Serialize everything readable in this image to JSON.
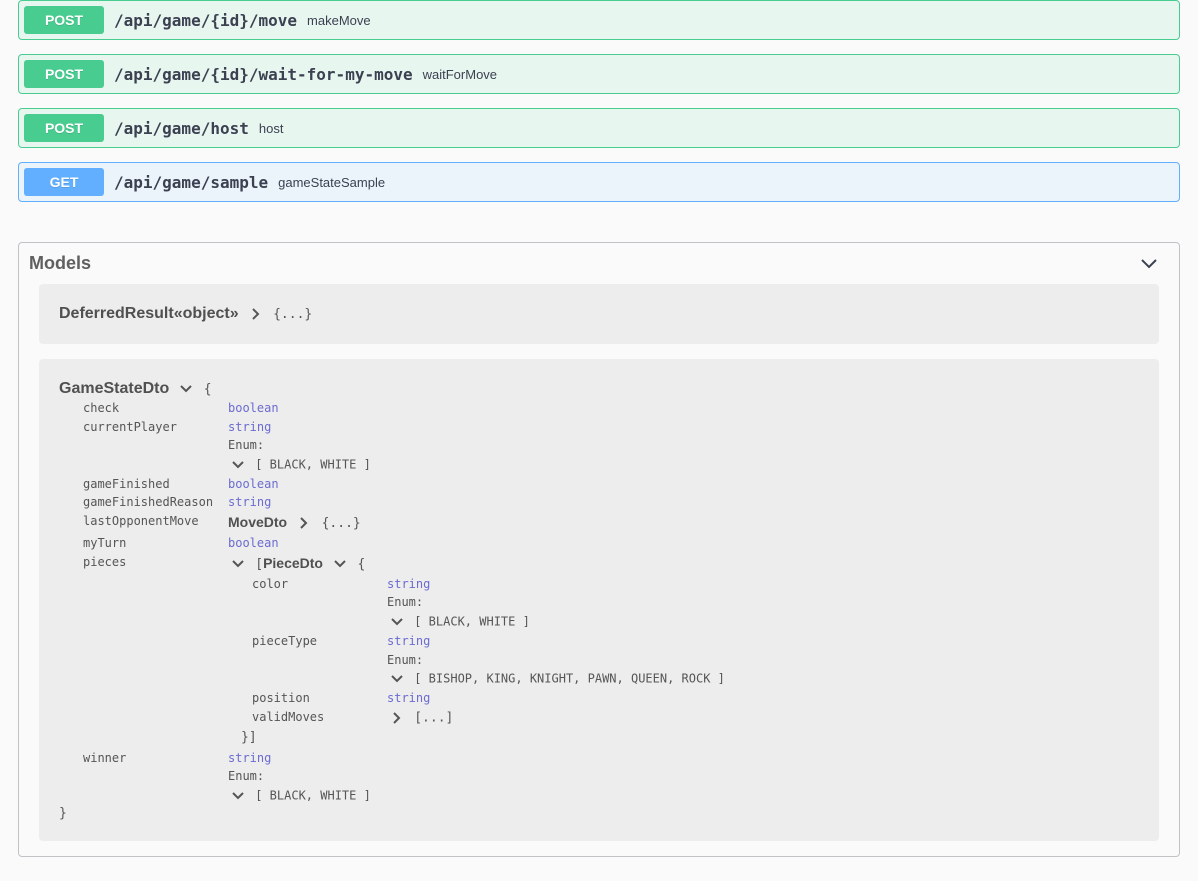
{
  "endpoints": [
    {
      "method": "POST",
      "path": "/api/game/{id}/move",
      "summary": "makeMove",
      "cls": "post"
    },
    {
      "method": "POST",
      "path": "/api/game/{id}/wait-for-my-move",
      "summary": "waitForMove",
      "cls": "post"
    },
    {
      "method": "POST",
      "path": "/api/game/host",
      "summary": "host",
      "cls": "post"
    },
    {
      "method": "GET",
      "path": "/api/game/sample",
      "summary": "gameStateSample",
      "cls": "get"
    }
  ],
  "models": {
    "section_title": "Models",
    "collapsed_preview": "{...}",
    "deferred": {
      "name": "DeferredResult«object»",
      "preview": "{...}"
    },
    "gamestate": {
      "name": "GameStateDto",
      "open": "{",
      "close": "}",
      "props": {
        "check": {
          "label": "check",
          "type": "boolean"
        },
        "currentPlayer": {
          "label": "currentPlayer",
          "type": "string",
          "enum_label": "Enum:",
          "enum": "[ BLACK, WHITE ]"
        },
        "gameFinished": {
          "label": "gameFinished",
          "type": "boolean"
        },
        "gameFinishedReason": {
          "label": "gameFinishedReason",
          "type": "string"
        },
        "lastOpponentMove": {
          "label": "lastOpponentMove",
          "ref": "MoveDto",
          "preview": "{...}"
        },
        "myTurn": {
          "label": "myTurn",
          "type": "boolean"
        },
        "pieces": {
          "label": "pieces",
          "array_open": "[",
          "ref": "PieceDto",
          "open": "{",
          "props": {
            "color": {
              "label": "color",
              "type": "string",
              "enum_label": "Enum:",
              "enum": "[ BLACK, WHITE ]"
            },
            "pieceType": {
              "label": "pieceType",
              "type": "string",
              "enum_label": "Enum:",
              "enum": "[ BISHOP, KING, KNIGHT, PAWN, QUEEN, ROCK ]"
            },
            "position": {
              "label": "position",
              "type": "string"
            },
            "validMoves": {
              "label": "validMoves",
              "preview": "[...]"
            }
          },
          "close": "}]"
        },
        "winner": {
          "label": "winner",
          "type": "string",
          "enum_label": "Enum:",
          "enum": "[ BLACK, WHITE ]"
        }
      }
    }
  }
}
